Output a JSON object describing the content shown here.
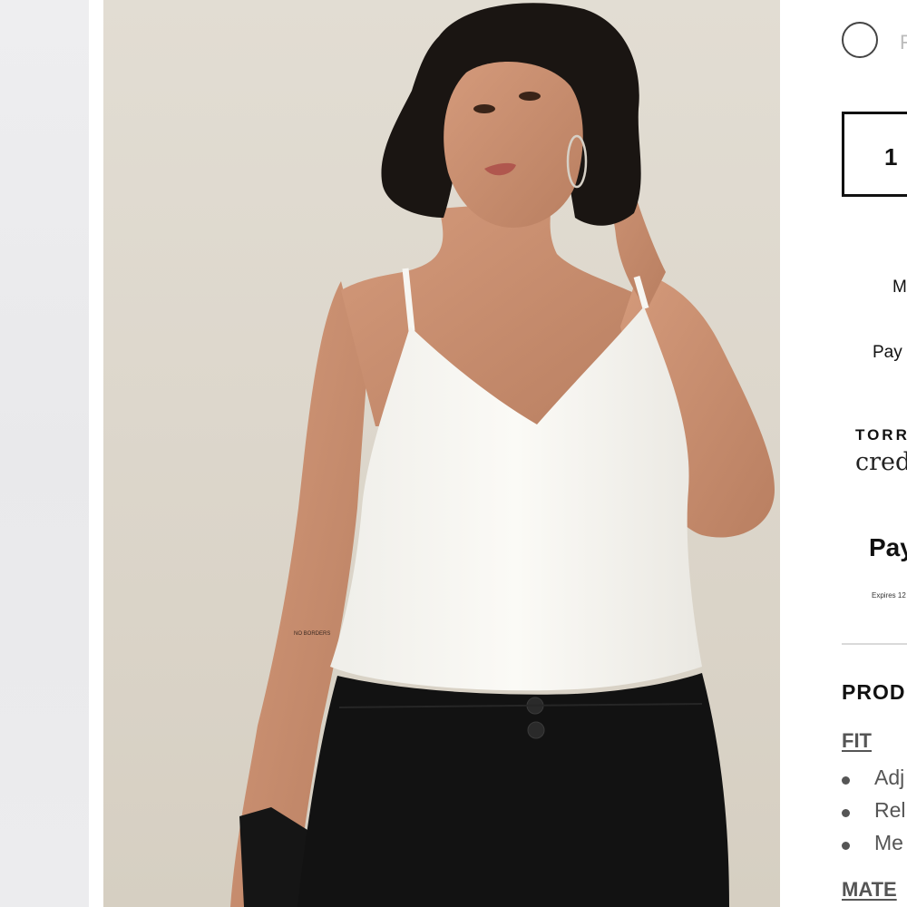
{
  "product_image": {
    "alt_subject": "model-wearing-white-cami",
    "tattoo_text": "NO BORDERS",
    "colors": {
      "background": "#ddd7cc",
      "top": "#f8f7f3",
      "pants": "#121212",
      "skin": "#c99072",
      "hair": "#1a1512"
    }
  },
  "color_swatch": {
    "label": "F"
  },
  "quantity": {
    "value": "1"
  },
  "promos": {
    "line1": "M",
    "line2": "Pay"
  },
  "torrid_credit": {
    "brand": "TORR",
    "script": "cred"
  },
  "paypal": {
    "text": "Pay",
    "expires": "Expires 12"
  },
  "details": {
    "section_title": "PROD",
    "fit_title": "FIT",
    "fit_items": [
      "Adj",
      "Rel",
      "Me"
    ],
    "material_title": "MATE"
  }
}
